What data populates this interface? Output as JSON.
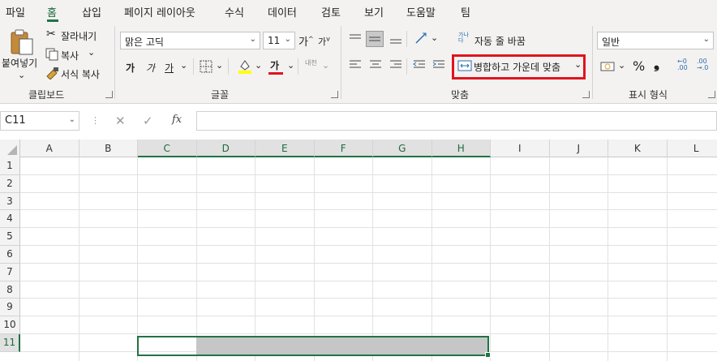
{
  "menu": {
    "tabs": [
      {
        "label": "파일",
        "active": false
      },
      {
        "label": "홈",
        "active": true
      },
      {
        "label": "삽입",
        "active": false
      },
      {
        "label": "페이지 레이아웃",
        "active": false
      },
      {
        "label": "수식",
        "active": false
      },
      {
        "label": "데이터",
        "active": false
      },
      {
        "label": "검토",
        "active": false
      },
      {
        "label": "보기",
        "active": false
      },
      {
        "label": "도움말",
        "active": false
      },
      {
        "label": "팀",
        "active": false
      }
    ]
  },
  "clipboard": {
    "paste_label": "붙여넣기",
    "cut_label": "잘라내기",
    "copy_label": "복사",
    "format_painter_label": "서식 복사",
    "group_label": "클립보드"
  },
  "font": {
    "font_name": "맑은 고딕",
    "font_size": "11",
    "bold_glyph": "가",
    "italic_glyph": "가",
    "underline_glyph": "가",
    "grow_glyph": "가",
    "shrink_glyph": "가",
    "font_color_glyph": "가",
    "phonetic_glyph": "내천",
    "group_label": "글꼴"
  },
  "alignment": {
    "wrap_text_label": "자동 줄 바꿈",
    "merge_center_label": "병합하고 가운데 맞춤",
    "group_label": "맞춤"
  },
  "number": {
    "format_value": "일반",
    "percent_glyph": "%",
    "comma_glyph": "❟",
    "group_label": "표시 형식"
  },
  "formula_bar": {
    "name_box": "C11",
    "fx_glyph": "fx",
    "cancel_glyph": "✕",
    "enter_glyph": "✓",
    "dots_glyph": "⋮",
    "formula_value": ""
  },
  "sheet": {
    "columns": [
      "A",
      "B",
      "C",
      "D",
      "E",
      "F",
      "G",
      "H",
      "I",
      "J",
      "K",
      "L"
    ],
    "rows": [
      "1",
      "2",
      "3",
      "4",
      "5",
      "6",
      "7",
      "8",
      "9",
      "10",
      "11"
    ],
    "selected_columns": [
      "C",
      "D",
      "E",
      "F",
      "G",
      "H"
    ],
    "selected_row": "11",
    "active_cell": "C11",
    "selection_range": "C11:H11"
  },
  "colors": {
    "accent": "#217346",
    "highlight_box": "#e0141e",
    "ribbon_bg": "#f3f2f1",
    "selection_fill": "#c6c6c6"
  }
}
